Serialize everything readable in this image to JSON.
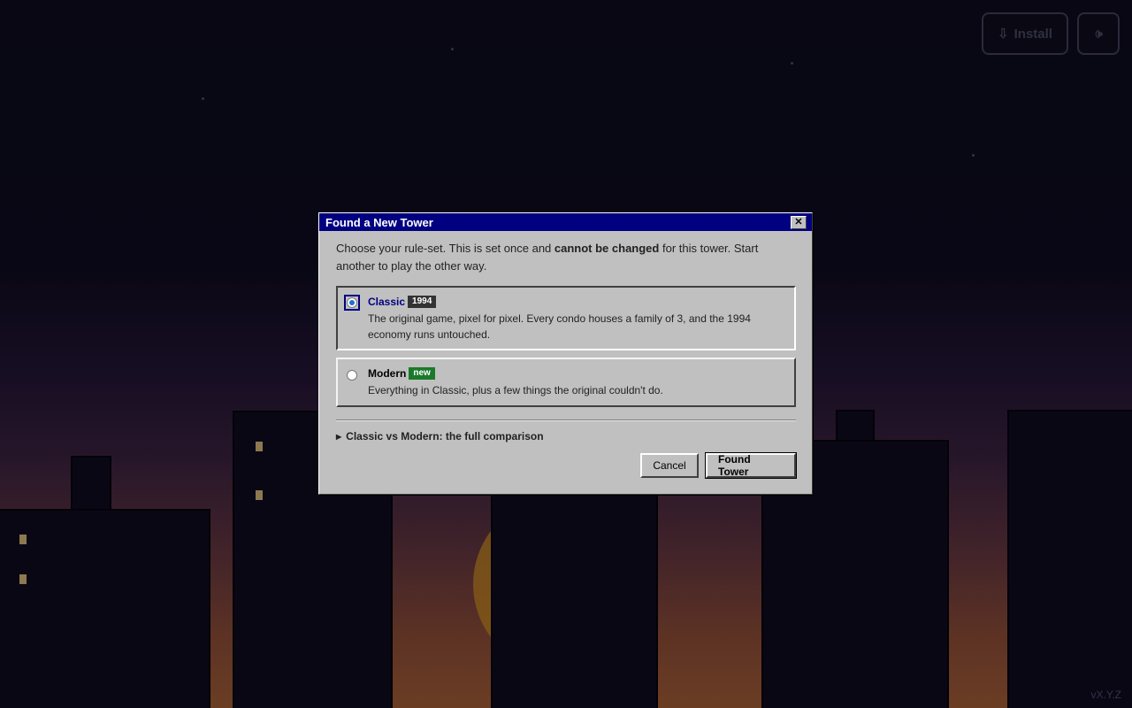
{
  "top_bar": {
    "install_icon": "download-icon",
    "install_label": "Install",
    "sound_icon": "speaker-icon"
  },
  "version": "vX.Y.Z",
  "dialog": {
    "title": "Found a New Tower",
    "close_icon": "close-icon",
    "intro_before": "Choose your rule-set. This is set once and ",
    "intro_bold": "cannot be changed",
    "intro_after": " for this tower. Start another to play the other way.",
    "options": [
      {
        "title": "Classic",
        "badge": "1994",
        "badge_color": "#333333",
        "description": "The original game, pixel for pixel. Every condo houses a family of 3, and the 1994 economy runs untouched.",
        "selected": true
      },
      {
        "title": "Modern",
        "badge": "new",
        "badge_color": "#1a7a2a",
        "description": "Everything in Classic, plus a few things the original couldn't do.",
        "selected": false
      }
    ],
    "comparison_label": "Classic vs Modern: the full comparison",
    "cancel_label": "Cancel",
    "confirm_label": "Found Tower"
  },
  "colors": {
    "titlebar": "#000080",
    "dialog_bg": "#c0c0c0"
  }
}
